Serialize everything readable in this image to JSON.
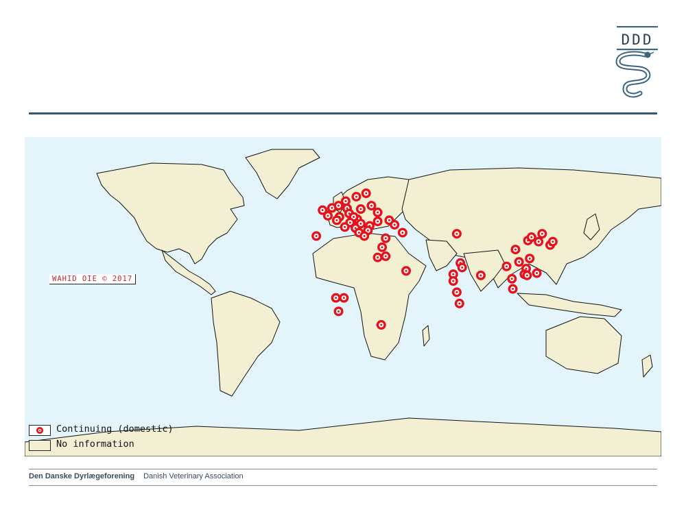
{
  "logo": {
    "text": "DDD",
    "icon": "worm-caduceus-icon",
    "color": "#3b6480"
  },
  "map": {
    "copyright": "WAHID OIE © 2017",
    "ocean_color": "#e3f4fb",
    "land_color": "#f2efd2",
    "marker_color": "#e4121b",
    "markers": [
      {
        "lat": 51.5,
        "lon": -0.5
      },
      {
        "lat": 52.5,
        "lon": 4.8
      },
      {
        "lat": 53.5,
        "lon": 8.5
      },
      {
        "lat": 52.3,
        "lon": 13.3
      },
      {
        "lat": 55.5,
        "lon": 12.5
      },
      {
        "lat": 57.5,
        "lon": 18.5
      },
      {
        "lat": 59.0,
        "lon": 24.0
      },
      {
        "lat": 52.0,
        "lon": 21.0
      },
      {
        "lat": 50.0,
        "lon": 14.5
      },
      {
        "lat": 48.5,
        "lon": 9.0
      },
      {
        "lat": 49.0,
        "lon": 2.5
      },
      {
        "lat": 47.0,
        "lon": 7.5
      },
      {
        "lat": 47.5,
        "lon": 19.0
      },
      {
        "lat": 48.5,
        "lon": 17.0
      },
      {
        "lat": 46.0,
        "lon": 15.0
      },
      {
        "lat": 45.5,
        "lon": 21.0
      },
      {
        "lat": 44.5,
        "lon": 26.0
      },
      {
        "lat": 42.5,
        "lon": 25.0
      },
      {
        "lat": 43.5,
        "lon": 18.0
      },
      {
        "lat": 44.0,
        "lon": 12.0
      },
      {
        "lat": 41.5,
        "lon": 20.0
      },
      {
        "lat": 40.0,
        "lon": 23.0
      },
      {
        "lat": 40.0,
        "lon": -4.0
      },
      {
        "lat": 46.5,
        "lon": 30.5
      },
      {
        "lat": 50.5,
        "lon": 30.5
      },
      {
        "lat": 53.5,
        "lon": 27.0
      },
      {
        "lat": 47.0,
        "lon": 37.0
      },
      {
        "lat": 45.0,
        "lon": 40.0
      },
      {
        "lat": 41.5,
        "lon": 44.5
      },
      {
        "lat": 39.0,
        "lon": 35.0
      },
      {
        "lat": 35.0,
        "lon": 33.0
      },
      {
        "lat": 31.0,
        "lon": 35.0
      },
      {
        "lat": 30.5,
        "lon": 30.5
      },
      {
        "lat": 24.5,
        "lon": 46.5
      },
      {
        "lat": 41.0,
        "lon": 75.0
      },
      {
        "lat": 34.0,
        "lon": 108.0
      },
      {
        "lat": 38.0,
        "lon": 115.0
      },
      {
        "lat": 39.5,
        "lon": 117.0
      },
      {
        "lat": 37.5,
        "lon": 121.0
      },
      {
        "lat": 41.0,
        "lon": 123.0
      },
      {
        "lat": 36.0,
        "lon": 127.5
      },
      {
        "lat": 37.5,
        "lon": 129.0
      },
      {
        "lat": 28.5,
        "lon": 110.0
      },
      {
        "lat": 30.0,
        "lon": 116.0
      },
      {
        "lat": 26.5,
        "lon": 103.0
      },
      {
        "lat": 25.5,
        "lon": 114.0
      },
      {
        "lat": 23.5,
        "lon": 120.0
      },
      {
        "lat": 23.0,
        "lon": 113.0
      },
      {
        "lat": 22.5,
        "lon": 114.5
      },
      {
        "lat": 21.0,
        "lon": 106.0
      },
      {
        "lat": 16.5,
        "lon": 106.5
      },
      {
        "lat": 28.0,
        "lon": 77.0
      },
      {
        "lat": 26.0,
        "lon": 78.0
      },
      {
        "lat": 22.5,
        "lon": 88.5
      },
      {
        "lat": 23.0,
        "lon": 73.0
      },
      {
        "lat": 20.0,
        "lon": 73.0
      },
      {
        "lat": 15.0,
        "lon": 75.0
      },
      {
        "lat": 10.0,
        "lon": 76.5
      },
      {
        "lat": 12.5,
        "lon": 7.0
      },
      {
        "lat": 12.5,
        "lon": 11.5
      },
      {
        "lat": 6.5,
        "lon": 8.5
      },
      {
        "lat": 0.5,
        "lon": 32.5
      }
    ]
  },
  "legend": {
    "items": [
      {
        "label": "Continuing (domestic)",
        "type": "marker"
      },
      {
        "label": "No information",
        "type": "land"
      }
    ]
  },
  "footer": {
    "org_danish": "Den Danske Dyrlægeforening",
    "org_english": "Danish Veterinary Association"
  }
}
